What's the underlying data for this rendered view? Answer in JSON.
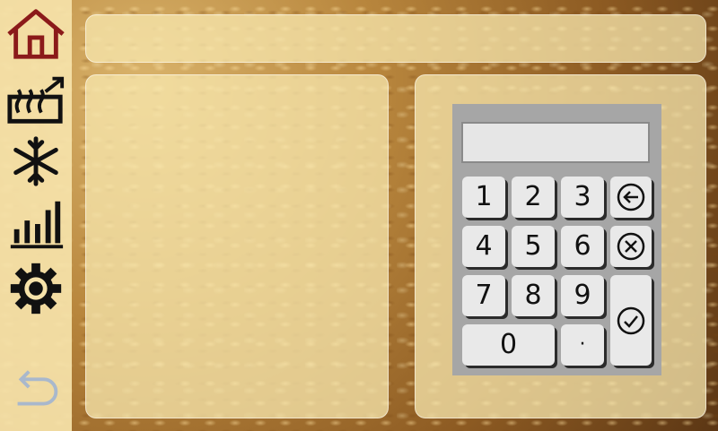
{
  "sidebar": {
    "icons": [
      "home-icon",
      "heat-export-icon",
      "snowflake-icon",
      "bar-chart-icon",
      "gear-icon",
      "back-arrow-icon"
    ]
  },
  "keypad": {
    "display_value": "",
    "keys": {
      "k1": "1",
      "k2": "2",
      "k3": "3",
      "k4": "4",
      "k5": "5",
      "k6": "6",
      "k7": "7",
      "k8": "8",
      "k9": "9",
      "k0": "0",
      "dot": "·"
    }
  },
  "colors": {
    "home_icon": "#8b1a1a",
    "icons": "#111111",
    "back_icon": "#a9b8cc",
    "sidebar_bg": "#f6e3aa",
    "keypad_bg": "#a6a6a6",
    "key_bg": "#e9e9e9"
  }
}
